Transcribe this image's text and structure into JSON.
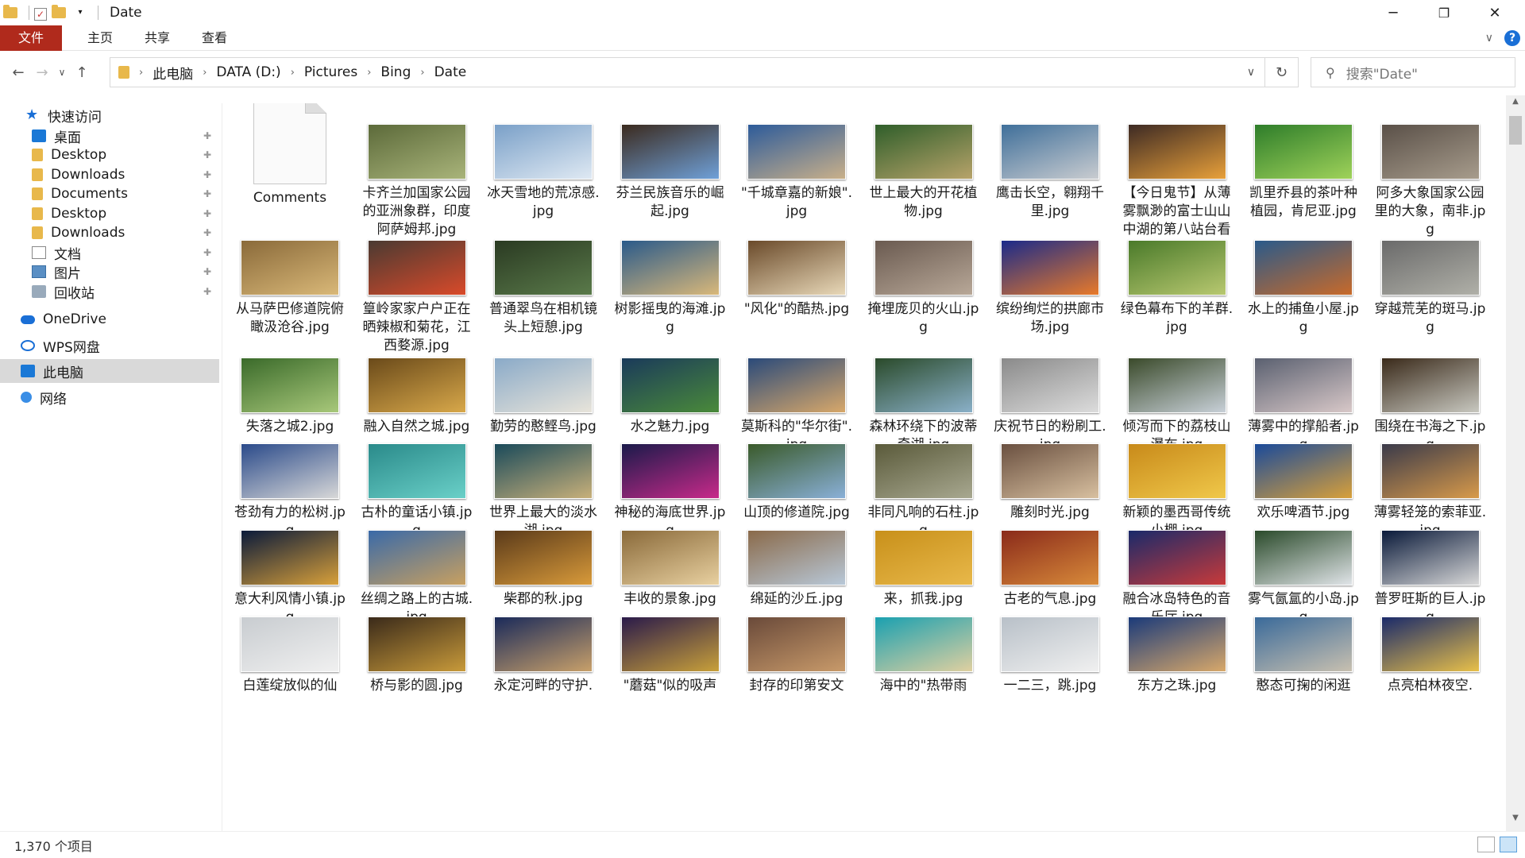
{
  "window": {
    "title": "Date",
    "minimize": "─",
    "maximize": "❐",
    "close": "✕"
  },
  "ribbon": {
    "tabs": [
      "文件",
      "主页",
      "共享",
      "查看"
    ],
    "collapse": "∨",
    "help": "?"
  },
  "nav": {
    "back": "←",
    "forward": "→",
    "recent": "∨",
    "up": "↑",
    "refresh": "↻",
    "dropdown": "∨"
  },
  "breadcrumb": [
    "此电脑",
    "DATA (D:)",
    "Pictures",
    "Bing",
    "Date"
  ],
  "search": {
    "placeholder": "搜索\"Date\""
  },
  "sidebar": {
    "items": [
      {
        "label": "快速访问",
        "icon": "star-icon",
        "pinned": false
      },
      {
        "label": "桌面",
        "icon": "desktop-icon",
        "pinned": true
      },
      {
        "label": "Desktop",
        "icon": "folder-icon",
        "pinned": true
      },
      {
        "label": "Downloads",
        "icon": "folder-icon",
        "pinned": true
      },
      {
        "label": "Documents",
        "icon": "folder-icon",
        "pinned": true
      },
      {
        "label": "Desktop",
        "icon": "folder-icon",
        "pinned": true
      },
      {
        "label": "Downloads",
        "icon": "folder-icon",
        "pinned": true
      },
      {
        "label": "文档",
        "icon": "document-icon",
        "pinned": true
      },
      {
        "label": "图片",
        "icon": "pictures-icon",
        "pinned": true
      },
      {
        "label": "回收站",
        "icon": "recycle-bin-icon",
        "pinned": true
      },
      {
        "label": "OneDrive",
        "icon": "cloud-icon",
        "pinned": false
      },
      {
        "label": "WPS网盘",
        "icon": "wps-cloud-icon",
        "pinned": false
      },
      {
        "label": "此电脑",
        "icon": "computer-icon",
        "pinned": false,
        "selected": true
      },
      {
        "label": "网络",
        "icon": "network-icon",
        "pinned": false
      }
    ],
    "pin_glyph": "📌"
  },
  "files": [
    {
      "name": "Comments",
      "type": "doc"
    },
    {
      "name": "卡齐兰加国家公园的亚洲象群，印度阿萨姆邦.jpg",
      "c1": "#5c6a3a",
      "c2": "#a9b47a"
    },
    {
      "name": "冰天雪地的荒凉感.jpg",
      "c1": "#7aa0c8",
      "c2": "#dfe9f3"
    },
    {
      "name": "芬兰民族音乐的崛起.jpg",
      "c1": "#3b2a1e",
      "c2": "#6fa0d8"
    },
    {
      "name": "\"千城章嘉的新娘\".jpg",
      "c1": "#2d5b9a",
      "c2": "#c9b08a"
    },
    {
      "name": "世上最大的开花植物.jpg",
      "c1": "#2f5e2a",
      "c2": "#b7a36a"
    },
    {
      "name": "鹰击长空，翱翔千里.jpg",
      "c1": "#3f6f9a",
      "c2": "#c9ccd0"
    },
    {
      "name": "【今日鬼节】从薄雾飘渺的富士山山中湖的第八站台看日出，...",
      "c1": "#3d2a24",
      "c2": "#e8a03a"
    },
    {
      "name": "凯里乔县的茶叶种植园，肯尼亚.jpg",
      "c1": "#2e7d2a",
      "c2": "#9fd25a"
    },
    {
      "name": "阿多大象国家公园里的大象，南非.jpg",
      "c1": "#5a5048",
      "c2": "#a79c8c"
    },
    {
      "name": "从马萨巴修道院俯瞰汲沧谷.jpg",
      "c1": "#8a6a3a",
      "c2": "#d9b878"
    },
    {
      "name": "篁岭家家户户正在晒辣椒和菊花，江西婺源.jpg",
      "c1": "#4a3a32",
      "c2": "#d94a2a"
    },
    {
      "name": "普通翠鸟在相机镜头上短憩.jpg",
      "c1": "#2a3a22",
      "c2": "#5a7a4a"
    },
    {
      "name": "树影摇曳的海滩.jpg",
      "c1": "#2a5a8a",
      "c2": "#d9b87a"
    },
    {
      "name": "\"风化\"的酷热.jpg",
      "c1": "#6a4a2a",
      "c2": "#e8d8b8"
    },
    {
      "name": "掩埋庞贝的火山.jpg",
      "c1": "#6a5a50",
      "c2": "#b8a898"
    },
    {
      "name": "缤纷绚烂的拱廊市场.jpg",
      "c1": "#1a2a8a",
      "c2": "#e87a2a"
    },
    {
      "name": "绿色幕布下的羊群.jpg",
      "c1": "#4a7a2a",
      "c2": "#b8c870"
    },
    {
      "name": "水上的捕鱼小屋.jpg",
      "c1": "#2a5a8a",
      "c2": "#c86a2a"
    },
    {
      "name": "穿越荒芜的斑马.jpg",
      "c1": "#6a6a6a",
      "c2": "#b0b0a8"
    },
    {
      "name": "失落之城2.jpg",
      "c1": "#3a6a2a",
      "c2": "#a8c87a"
    },
    {
      "name": "融入自然之城.jpg",
      "c1": "#6a4a1a",
      "c2": "#d8a84a"
    },
    {
      "name": "勤劳的憨鲣鸟.jpg",
      "c1": "#8aaac8",
      "c2": "#e8e4da"
    },
    {
      "name": "水之魅力.jpg",
      "c1": "#1a3a5a",
      "c2": "#4a8a3a"
    },
    {
      "name": "莫斯科的\"华尔街\".jpg",
      "c1": "#2a4a7a",
      "c2": "#d8a86a"
    },
    {
      "name": "森林环绕下的波蒂奇湖.jpg",
      "c1": "#2a4a2a",
      "c2": "#8ab0c8"
    },
    {
      "name": "庆祝节日的粉刷工.jpg",
      "c1": "#8a8a8a",
      "c2": "#dcdcdc"
    },
    {
      "name": "倾泻而下的荔枝山瀑布.jpg",
      "c1": "#3a4a2a",
      "c2": "#c8d0d8"
    },
    {
      "name": "薄雾中的撑船者.jpg",
      "c1": "#5a6070",
      "c2": "#d8c8c8"
    },
    {
      "name": "围绕在书海之下.jpg",
      "c1": "#3a2a1a",
      "c2": "#c8c8c0"
    },
    {
      "name": "苍劲有力的松树.jpg",
      "c1": "#2a4a8a",
      "c2": "#d8d8d8"
    },
    {
      "name": "古朴的童话小镇.jpg",
      "c1": "#2a8a8a",
      "c2": "#6ad0c8"
    },
    {
      "name": "世界上最大的淡水湖.jpg",
      "c1": "#1a4a5a",
      "c2": "#c8b07a"
    },
    {
      "name": "神秘的海底世界.jpg",
      "c1": "#1a1a4a",
      "c2": "#c82a8a"
    },
    {
      "name": "山顶的修道院.jpg",
      "c1": "#3a5a2a",
      "c2": "#8ab0d8"
    },
    {
      "name": "非同凡响的石柱.jpg",
      "c1": "#5a5a3a",
      "c2": "#a8a890"
    },
    {
      "name": "雕刻时光.jpg",
      "c1": "#6a5040",
      "c2": "#d8c0a0"
    },
    {
      "name": "新颖的墨西哥传统小棚.jpg",
      "c1": "#c88a1a",
      "c2": "#f0c84a"
    },
    {
      "name": "欢乐啤酒节.jpg",
      "c1": "#1a4a9a",
      "c2": "#d8a03a"
    },
    {
      "name": "薄雾轻笼的索菲亚.jpg",
      "c1": "#3a3a4a",
      "c2": "#d89a4a"
    },
    {
      "name": "意大利风情小镇.jpg",
      "c1": "#0a1a3a",
      "c2": "#d8a03a"
    },
    {
      "name": "丝绸之路上的古城.jpg",
      "c1": "#3a6aa8",
      "c2": "#c8a060"
    },
    {
      "name": "柴郡的秋.jpg",
      "c1": "#5a3a1a",
      "c2": "#d89a3a"
    },
    {
      "name": "丰收的景象.jpg",
      "c1": "#8a6a3a",
      "c2": "#e8d0a0"
    },
    {
      "name": "绵延的沙丘.jpg",
      "c1": "#8a6a4a",
      "c2": "#b8c8d8"
    },
    {
      "name": "来，抓我.jpg",
      "c1": "#c8901a",
      "c2": "#e8b84a"
    },
    {
      "name": "古老的气息.jpg",
      "c1": "#8a2a1a",
      "c2": "#d88a3a"
    },
    {
      "name": "融合冰岛特色的音乐厅.jpg",
      "c1": "#1a2a6a",
      "c2": "#c83a3a"
    },
    {
      "name": "雾气氤氲的小岛.jpg",
      "c1": "#2a4a2a",
      "c2": "#e0e4e8"
    },
    {
      "name": "普罗旺斯的巨人.jpg",
      "c1": "#0a1a3a",
      "c2": "#d8d8d8"
    },
    {
      "name": "白莲绽放似的仙",
      "c1": "#c8ccd0",
      "c2": "#f0f0f0"
    },
    {
      "name": "桥与影的圆.jpg",
      "c1": "#3a2a1a",
      "c2": "#c89a3a"
    },
    {
      "name": "永定河畔的守护.",
      "c1": "#1a2a5a",
      "c2": "#c8a06a"
    },
    {
      "name": "\"蘑菇\"似的吸声",
      "c1": "#2a1a4a",
      "c2": "#c8a03a"
    },
    {
      "name": "封存的印第安文",
      "c1": "#6a4a3a",
      "c2": "#c89a6a"
    },
    {
      "name": "海中的\"热带雨",
      "c1": "#1aa0b0",
      "c2": "#e0d0a0"
    },
    {
      "name": "一二三，跳.jpg",
      "c1": "#b8c0c8",
      "c2": "#f0f0f0"
    },
    {
      "name": "东方之珠.jpg",
      "c1": "#1a3a7a",
      "c2": "#d8a86a"
    },
    {
      "name": "憨态可掬的闲逛",
      "c1": "#3a6a9a",
      "c2": "#c8c0b0"
    },
    {
      "name": "点亮柏林夜空.",
      "c1": "#1a2a6a",
      "c2": "#e8c04a"
    }
  ],
  "status": {
    "count": "1,370 个项目"
  }
}
